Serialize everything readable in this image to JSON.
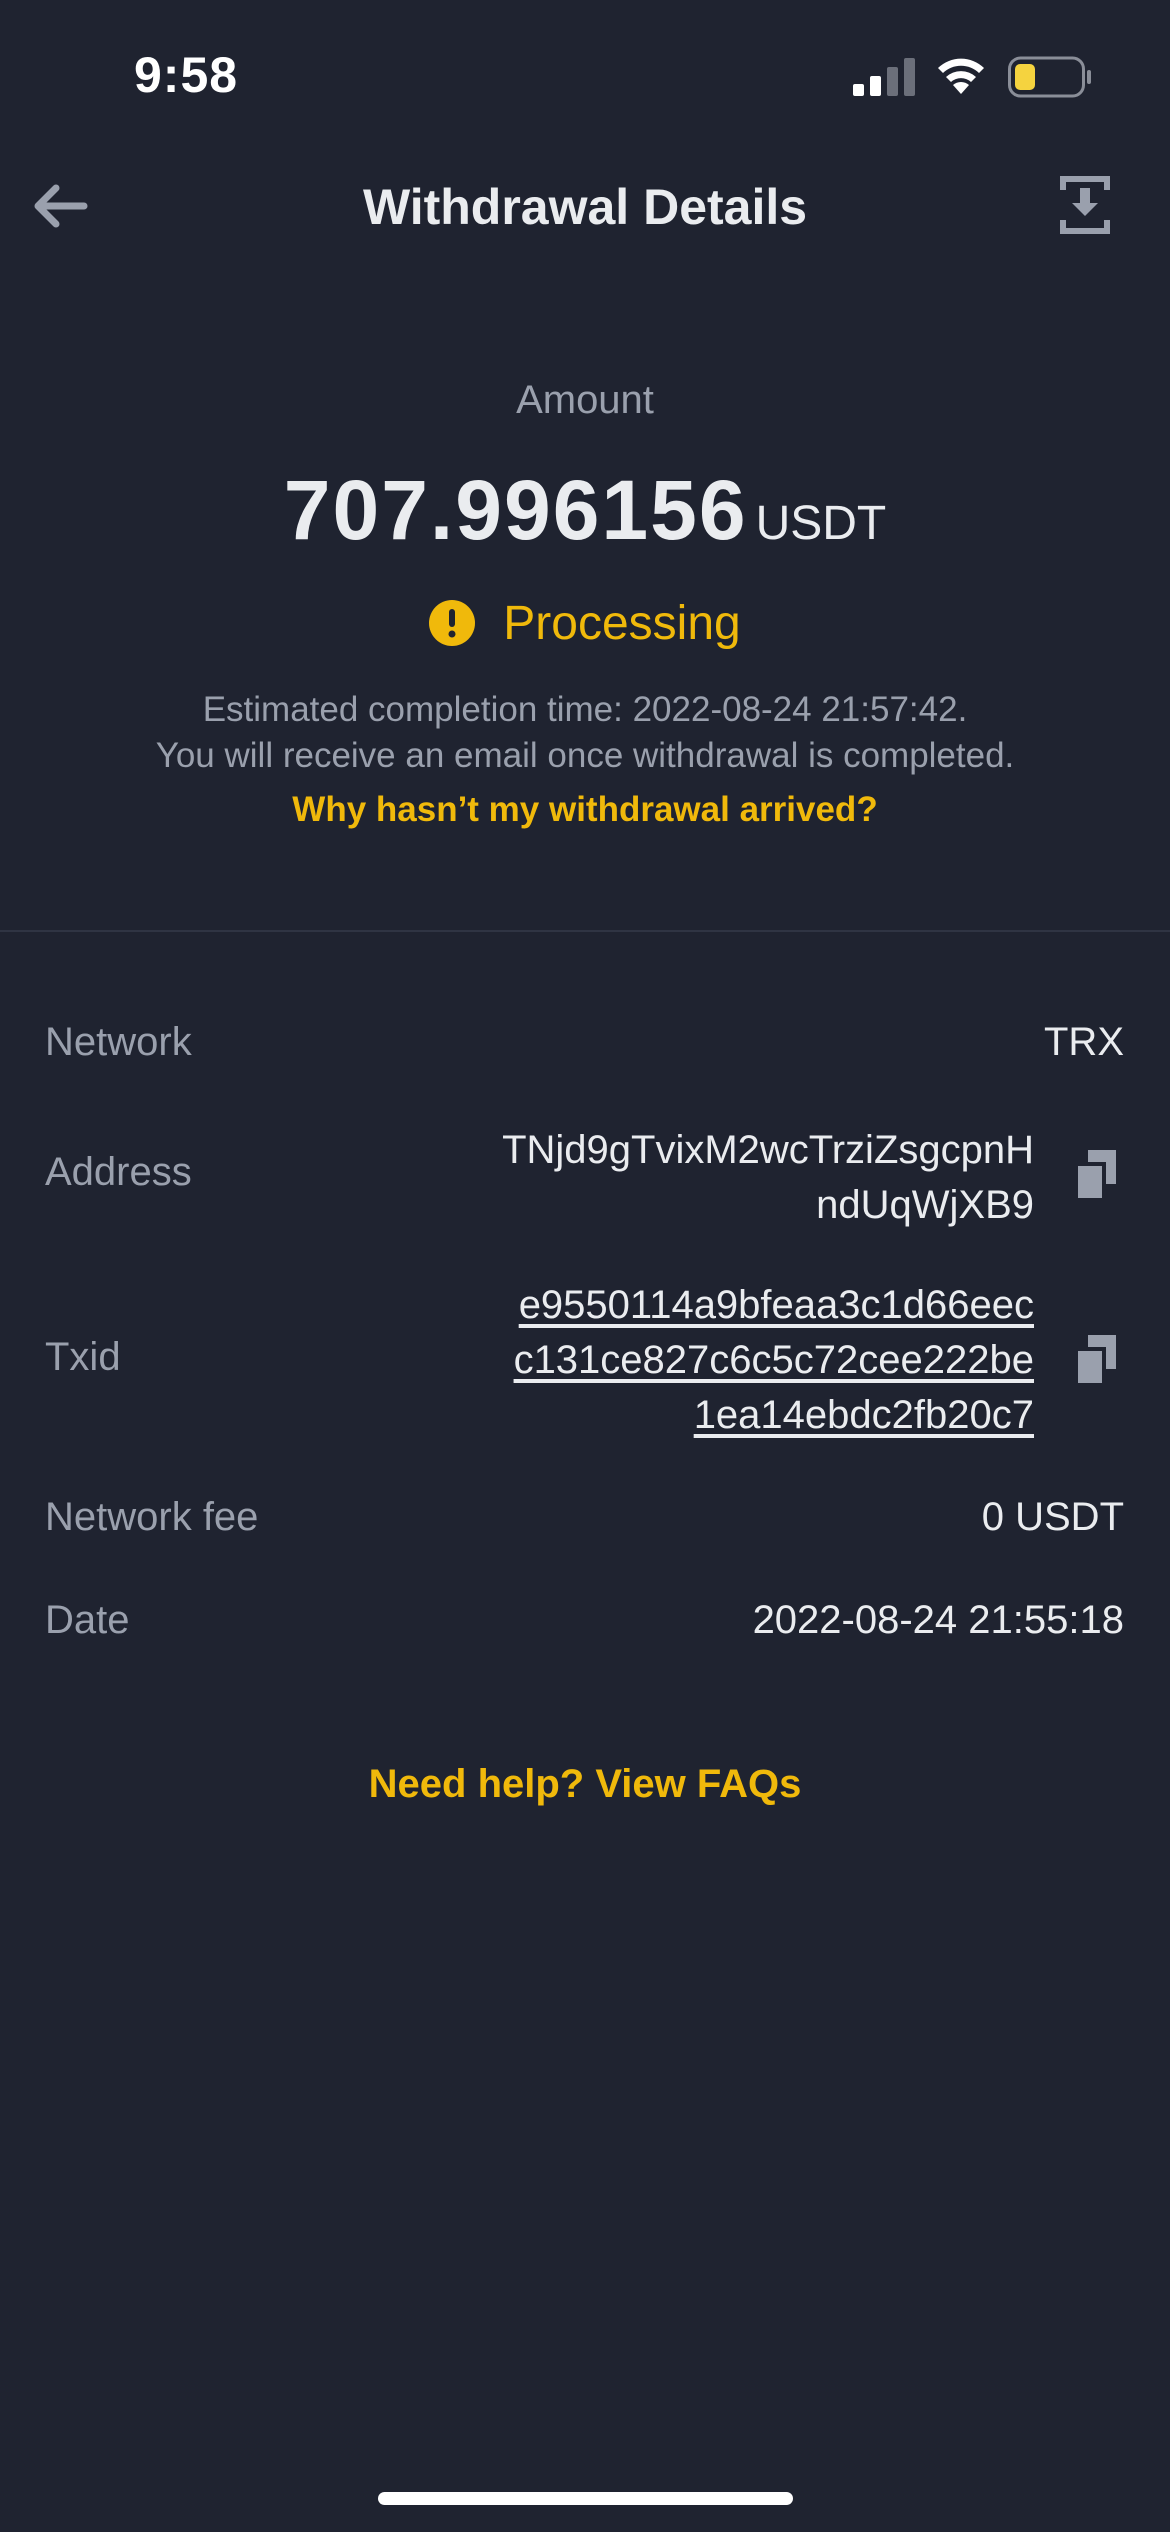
{
  "status_bar": {
    "time": "9:58"
  },
  "header": {
    "title": "Withdrawal Details",
    "back_icon": "arrow-left-icon",
    "action_icon": "download-icon"
  },
  "summary": {
    "amount_label": "Amount",
    "amount_value": "707.996156",
    "amount_unit": "USDT",
    "status": "Processing",
    "status_icon": "exclamation-circle-icon",
    "estimated_completion": "Estimated completion time: 2022-08-24 21:57:42.",
    "email_note": "You will receive an email once withdrawal is completed.",
    "why_link": "Why hasn’t my withdrawal arrived?"
  },
  "details": {
    "network": {
      "label": "Network",
      "value": "TRX"
    },
    "address": {
      "label": "Address",
      "lines": [
        "TNjd9gTvixM2wcTrziZsgcpnH",
        "ndUqWjXB9"
      ]
    },
    "txid": {
      "label": "Txid",
      "lines": [
        "e9550114a9bfeaa3c1d66eec",
        "c131ce827c6c5c72cee222be",
        "1ea14ebdc2fb20c7"
      ]
    },
    "network_fee": {
      "label": "Network fee",
      "value": "0 USDT"
    },
    "date": {
      "label": "Date",
      "value": "2022-08-24 21:55:18"
    }
  },
  "footer": {
    "faq_link": "Need help? View FAQs"
  },
  "colors": {
    "background": "#1f2330",
    "accent": "#f0b90b",
    "text_primary": "#eaecef",
    "text_secondary": "#9aa0ad",
    "battery_fill": "#f5d33f"
  }
}
